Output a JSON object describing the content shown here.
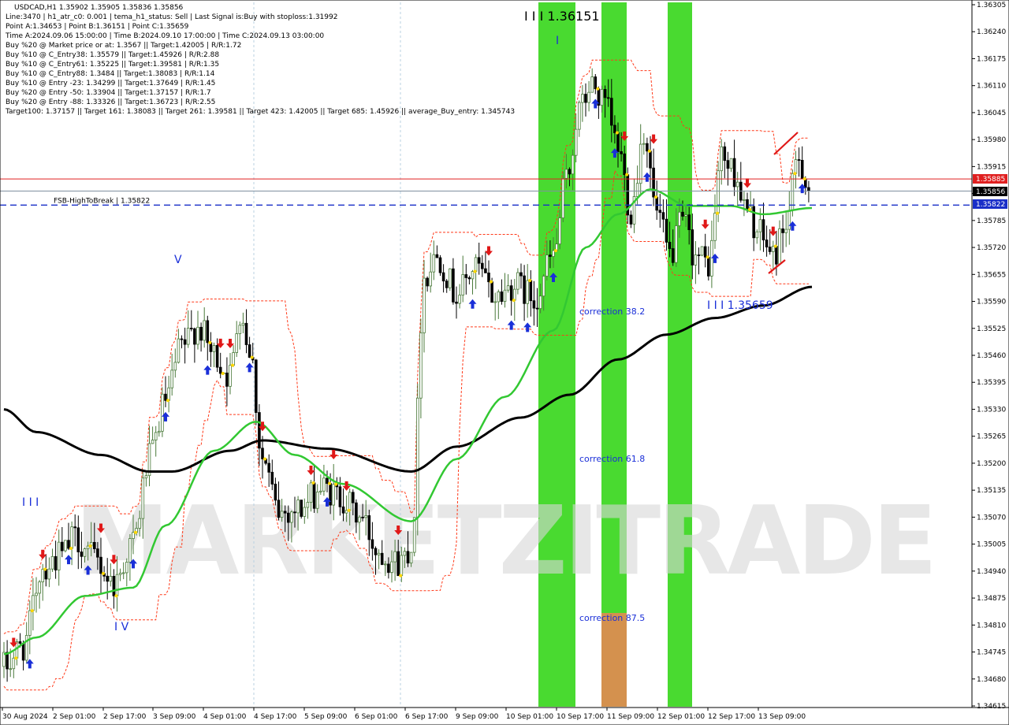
{
  "header": {
    "symbol_line": "USDCAD,H1  1.35902 1.35905 1.35836 1.35856",
    "info_lines": [
      "Line:3470 | h1_atr_c0: 0.001 | tema_h1_status: Sell | Last Signal is:Buy with stoploss:1.31992",
      "Point A:1.34653 | Point B:1.36151 | Point C:1.35659",
      "Time A:2024.09.06 15:00:00 | Time B:2024.09.10 17:00:00 | Time C:2024.09.13 03:00:00",
      "Buy %20 @ Market price or at: 1.3567 || Target:1.42005 | R/R:1.72",
      "Buy %10 @ C_Entry38: 1.35579 || Target:1.45926 | R/R:2.88",
      "Buy %10 @ C_Entry61: 1.35225 || Target:1.39581 | R/R:1.35",
      "Buy %10 @ C_Entry88: 1.3484 || Target:1.38083 | R/R:1.14",
      "Buy %10 @ Entry -23: 1.34299 || Target:1.37649 | R/R:1.45",
      "Buy %20 @ Entry -50: 1.33904 || Target:1.37157 | R/R:1.7",
      "Buy %20 @ Entry -88: 1.33326 || Target:1.36723 | R/R:2.55",
      "Target100: 1.37157 || Target 161: 1.38083 || Target 261: 1.39581 || Target 423: 1.42005 || Target 685: 1.45926 || average_Buy_entry: 1.345743"
    ]
  },
  "colors": {
    "background": "#ffffff",
    "bull_candle": "#4a7a3a",
    "bear_candle": "#000000",
    "green_band": "#35d61a",
    "orange_band": "#d4914e",
    "ma_fast": "#32c832",
    "ma_slow": "#000000",
    "resistance_line": "#e02020",
    "fsb_line": "#1a2fc8",
    "channel": "#ff3a1a",
    "buy_arrow": "#1a2fd8",
    "sell_arrow": "#e01818",
    "watermark": "#d8d8d8"
  },
  "watermark_text": "MARKETZITRADE",
  "chart_data": {
    "type": "candlestick",
    "symbol": "USDCAD",
    "timeframe": "H1",
    "ylim": [
      1.34615,
      1.36305
    ],
    "y_ticks": [
      "1.36305",
      "1.36240",
      "1.36175",
      "1.36110",
      "1.36045",
      "1.35980",
      "1.35915",
      "1.35850",
      "1.35785",
      "1.35720",
      "1.35655",
      "1.35590",
      "1.35525",
      "1.35460",
      "1.35395",
      "1.35330",
      "1.35265",
      "1.35200",
      "1.35135",
      "1.35070",
      "1.35005",
      "1.34940",
      "1.34875",
      "1.34810",
      "1.34745",
      "1.34680",
      "1.34615"
    ],
    "x_ticks": [
      "30 Aug 2024",
      "2 Sep 01:00",
      "2 Sep 17:00",
      "3 Sep 09:00",
      "4 Sep 01:00",
      "4 Sep 17:00",
      "5 Sep 09:00",
      "6 Sep 01:00",
      "6 Sep 17:00",
      "9 Sep 09:00",
      "10 Sep 01:00",
      "10 Sep 17:00",
      "11 Sep 09:00",
      "12 Sep 01:00",
      "12 Sep 17:00",
      "13 Sep 09:00"
    ],
    "bars_count": 250,
    "key_points": {
      "point_a": {
        "label": "1.34653",
        "price": 1.34653
      },
      "point_b": {
        "label": "I I I 1.36151",
        "price": 1.36151
      },
      "point_c": {
        "label": "I I I 1.35659",
        "price": 1.35659
      }
    },
    "price_lines": [
      {
        "name": "resistance",
        "price": 1.35885,
        "label": "1.35885",
        "color": "#e02020"
      },
      {
        "name": "last-price",
        "price": 1.35856,
        "label": "1.35856",
        "color": "#000000"
      },
      {
        "name": "fsb",
        "price": 1.35822,
        "label": "1.35822",
        "color": "#1a2fc8",
        "text": "FSB-HighToBreak | 1.35822"
      }
    ],
    "corrections": [
      {
        "label": "correction 38.2"
      },
      {
        "label": "correction 61.8"
      },
      {
        "label": "correction 87.5"
      }
    ],
    "wave_labels": [
      "I I I",
      "V",
      "I V",
      "I"
    ],
    "anchors": [
      {
        "bar": 0,
        "price": 1.3471
      },
      {
        "bar": 6,
        "price": 1.3476
      },
      {
        "bar": 12,
        "price": 1.3495
      },
      {
        "bar": 18,
        "price": 1.3498
      },
      {
        "bar": 22,
        "price": 1.3502
      },
      {
        "bar": 28,
        "price": 1.3497
      },
      {
        "bar": 34,
        "price": 1.3491
      },
      {
        "bar": 40,
        "price": 1.3501
      },
      {
        "bar": 45,
        "price": 1.3521
      },
      {
        "bar": 50,
        "price": 1.3535
      },
      {
        "bar": 55,
        "price": 1.3548
      },
      {
        "bar": 60,
        "price": 1.3553
      },
      {
        "bar": 65,
        "price": 1.3546
      },
      {
        "bar": 70,
        "price": 1.3541
      },
      {
        "bar": 73,
        "price": 1.3557
      },
      {
        "bar": 76,
        "price": 1.3548
      },
      {
        "bar": 80,
        "price": 1.3521
      },
      {
        "bar": 85,
        "price": 1.3508
      },
      {
        "bar": 92,
        "price": 1.3509
      },
      {
        "bar": 98,
        "price": 1.3514
      },
      {
        "bar": 104,
        "price": 1.3512
      },
      {
        "bar": 110,
        "price": 1.3507
      },
      {
        "bar": 116,
        "price": 1.3499
      },
      {
        "bar": 122,
        "price": 1.3496
      },
      {
        "bar": 126,
        "price": 1.35
      },
      {
        "bar": 130,
        "price": 1.3565
      },
      {
        "bar": 134,
        "price": 1.357
      },
      {
        "bar": 140,
        "price": 1.3561
      },
      {
        "bar": 146,
        "price": 1.3567
      },
      {
        "bar": 152,
        "price": 1.356
      },
      {
        "bar": 158,
        "price": 1.3563
      },
      {
        "bar": 164,
        "price": 1.356
      },
      {
        "bar": 170,
        "price": 1.357
      },
      {
        "bar": 174,
        "price": 1.3588
      },
      {
        "bar": 178,
        "price": 1.3605
      },
      {
        "bar": 182,
        "price": 1.3611
      },
      {
        "bar": 186,
        "price": 1.3606
      },
      {
        "bar": 190,
        "price": 1.3596
      },
      {
        "bar": 194,
        "price": 1.3581
      },
      {
        "bar": 198,
        "price": 1.36
      },
      {
        "bar": 202,
        "price": 1.358
      },
      {
        "bar": 206,
        "price": 1.357
      },
      {
        "bar": 210,
        "price": 1.3578
      },
      {
        "bar": 214,
        "price": 1.357
      },
      {
        "bar": 218,
        "price": 1.3568
      },
      {
        "bar": 222,
        "price": 1.3594
      },
      {
        "bar": 226,
        "price": 1.359
      },
      {
        "bar": 230,
        "price": 1.358
      },
      {
        "bar": 234,
        "price": 1.3575
      },
      {
        "bar": 238,
        "price": 1.357
      },
      {
        "bar": 242,
        "price": 1.3578
      },
      {
        "bar": 246,
        "price": 1.3594
      },
      {
        "bar": 249,
        "price": 1.35856
      }
    ],
    "ma_slow_anchors": [
      {
        "bar": 0,
        "price": 1.3533
      },
      {
        "bar": 10,
        "price": 1.35275
      },
      {
        "bar": 30,
        "price": 1.3522
      },
      {
        "bar": 45,
        "price": 1.3518
      },
      {
        "bar": 52,
        "price": 1.3518
      },
      {
        "bar": 70,
        "price": 1.3523
      },
      {
        "bar": 80,
        "price": 1.35255
      },
      {
        "bar": 100,
        "price": 1.35235
      },
      {
        "bar": 126,
        "price": 1.3518
      },
      {
        "bar": 140,
        "price": 1.3524
      },
      {
        "bar": 160,
        "price": 1.3531
      },
      {
        "bar": 175,
        "price": 1.35365
      },
      {
        "bar": 190,
        "price": 1.3545
      },
      {
        "bar": 205,
        "price": 1.3551
      },
      {
        "bar": 220,
        "price": 1.3555
      },
      {
        "bar": 235,
        "price": 1.3558
      },
      {
        "bar": 250,
        "price": 1.35625
      }
    ],
    "ma_fast_anchors": [
      {
        "bar": 0,
        "price": 1.3474
      },
      {
        "bar": 10,
        "price": 1.3478
      },
      {
        "bar": 25,
        "price": 1.3488
      },
      {
        "bar": 40,
        "price": 1.349
      },
      {
        "bar": 50,
        "price": 1.3505
      },
      {
        "bar": 65,
        "price": 1.3523
      },
      {
        "bar": 78,
        "price": 1.353
      },
      {
        "bar": 90,
        "price": 1.3522
      },
      {
        "bar": 105,
        "price": 1.3515
      },
      {
        "bar": 126,
        "price": 1.3506
      },
      {
        "bar": 140,
        "price": 1.3521
      },
      {
        "bar": 155,
        "price": 1.3536
      },
      {
        "bar": 170,
        "price": 1.3552
      },
      {
        "bar": 180,
        "price": 1.3572
      },
      {
        "bar": 190,
        "price": 1.358
      },
      {
        "bar": 200,
        "price": 1.3586
      },
      {
        "bar": 212,
        "price": 1.3582
      },
      {
        "bar": 225,
        "price": 1.3582
      },
      {
        "bar": 235,
        "price": 1.358
      },
      {
        "bar": 250,
        "price": 1.35815
      }
    ],
    "signals": [
      {
        "bar": 3,
        "type": "sell"
      },
      {
        "bar": 8,
        "type": "buy"
      },
      {
        "bar": 12,
        "type": "sell"
      },
      {
        "bar": 20,
        "type": "buy"
      },
      {
        "bar": 26,
        "type": "buy"
      },
      {
        "bar": 30,
        "type": "sell"
      },
      {
        "bar": 34,
        "type": "sell"
      },
      {
        "bar": 40,
        "type": "buy"
      },
      {
        "bar": 50,
        "type": "buy"
      },
      {
        "bar": 63,
        "type": "buy"
      },
      {
        "bar": 67,
        "type": "sell"
      },
      {
        "bar": 70,
        "type": "sell"
      },
      {
        "bar": 76,
        "type": "buy"
      },
      {
        "bar": 80,
        "type": "sell"
      },
      {
        "bar": 95,
        "type": "sell"
      },
      {
        "bar": 100,
        "type": "buy"
      },
      {
        "bar": 102,
        "type": "sell"
      },
      {
        "bar": 106,
        "type": "sell"
      },
      {
        "bar": 122,
        "type": "sell"
      },
      {
        "bar": 145,
        "type": "buy"
      },
      {
        "bar": 150,
        "type": "sell"
      },
      {
        "bar": 157,
        "type": "buy"
      },
      {
        "bar": 162,
        "type": "buy"
      },
      {
        "bar": 170,
        "type": "buy"
      },
      {
        "bar": 183,
        "type": "buy"
      },
      {
        "bar": 189,
        "type": "buy"
      },
      {
        "bar": 192,
        "type": "sell"
      },
      {
        "bar": 199,
        "type": "buy"
      },
      {
        "bar": 201,
        "type": "sell"
      },
      {
        "bar": 217,
        "type": "sell"
      },
      {
        "bar": 220,
        "type": "buy"
      },
      {
        "bar": 230,
        "type": "sell"
      },
      {
        "bar": 238,
        "type": "sell"
      },
      {
        "bar": 244,
        "type": "buy"
      },
      {
        "bar": 247,
        "type": "buy"
      }
    ]
  }
}
